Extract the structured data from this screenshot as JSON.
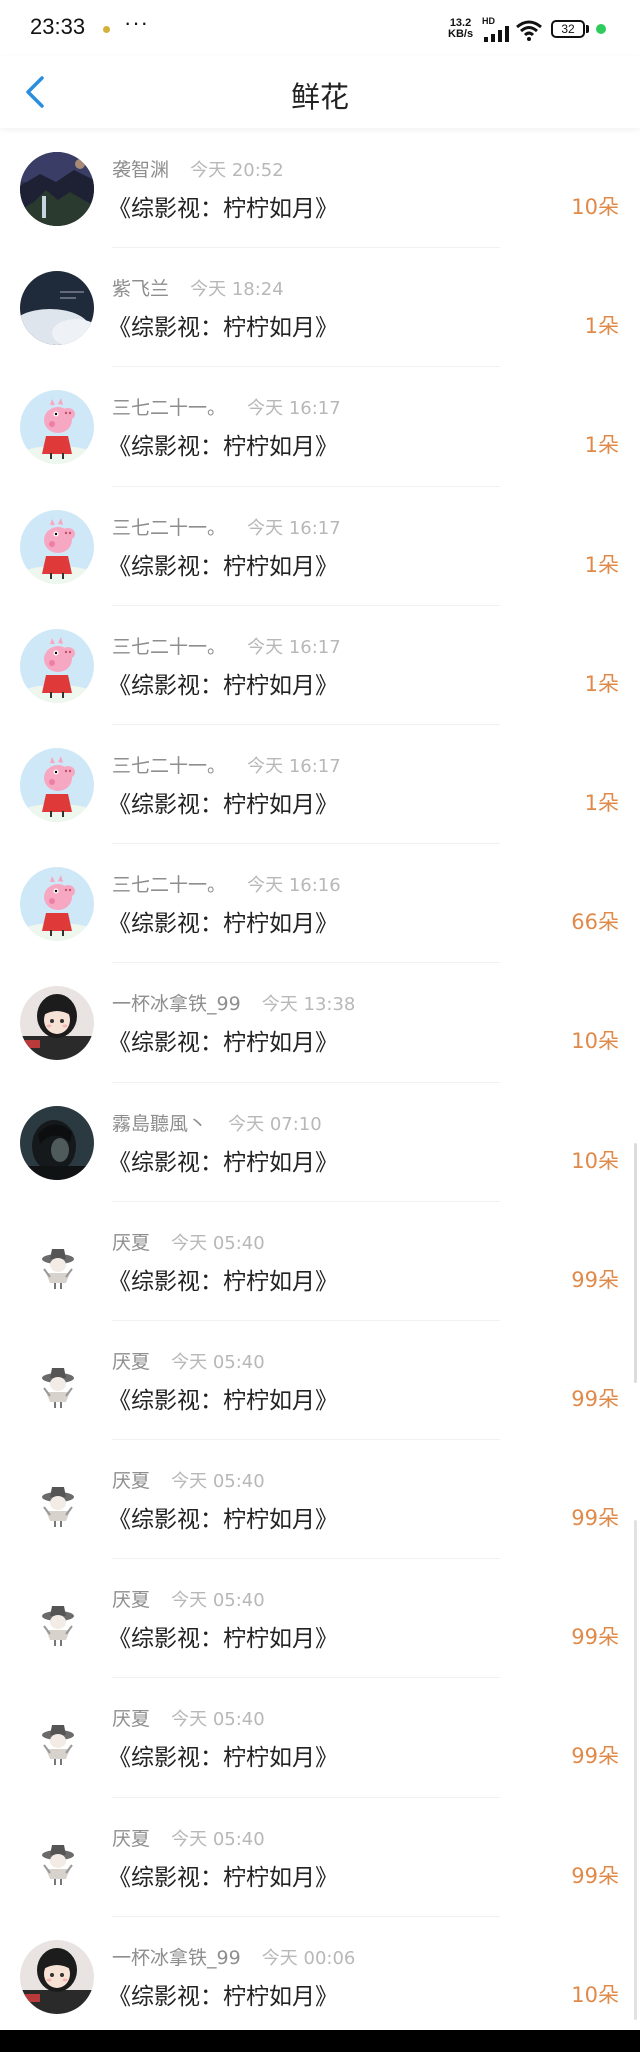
{
  "status": {
    "time": "23:33",
    "more": "···",
    "speed_top": "13.2",
    "speed_bottom": "KB/s",
    "hd": "HD",
    "battery": "32"
  },
  "nav": {
    "title": "鲜花"
  },
  "list": [
    {
      "user": "袭智渊",
      "time": "今天 20:52",
      "book": "《综影视：柠柠如月》",
      "count": "10朵",
      "avatar": "landscape"
    },
    {
      "user": "紫飞兰",
      "time": "今天 18:24",
      "book": "《综影视：柠柠如月》",
      "count": "1朵",
      "avatar": "sky"
    },
    {
      "user": "三七二十一。",
      "time": "今天 16:17",
      "book": "《综影视：柠柠如月》",
      "count": "1朵",
      "avatar": "peppa"
    },
    {
      "user": "三七二十一。",
      "time": "今天 16:17",
      "book": "《综影视：柠柠如月》",
      "count": "1朵",
      "avatar": "peppa"
    },
    {
      "user": "三七二十一。",
      "time": "今天 16:17",
      "book": "《综影视：柠柠如月》",
      "count": "1朵",
      "avatar": "peppa"
    },
    {
      "user": "三七二十一。",
      "time": "今天 16:17",
      "book": "《综影视：柠柠如月》",
      "count": "1朵",
      "avatar": "peppa"
    },
    {
      "user": "三七二十一。",
      "time": "今天 16:16",
      "book": "《综影视：柠柠如月》",
      "count": "66朵",
      "avatar": "peppa"
    },
    {
      "user": "一杯冰拿铁_99",
      "time": "今天 13:38",
      "book": "《综影视：柠柠如月》",
      "count": "10朵",
      "avatar": "girl"
    },
    {
      "user": "霧島聽風丶",
      "time": "今天 07:10",
      "book": "《综影视：柠柠如月》",
      "count": "10朵",
      "avatar": "dark"
    },
    {
      "user": "厌夏",
      "time": "今天 05:40",
      "book": "《综影视：柠柠如月》",
      "count": "99朵",
      "avatar": "sketch"
    },
    {
      "user": "厌夏",
      "time": "今天 05:40",
      "book": "《综影视：柠柠如月》",
      "count": "99朵",
      "avatar": "sketch"
    },
    {
      "user": "厌夏",
      "time": "今天 05:40",
      "book": "《综影视：柠柠如月》",
      "count": "99朵",
      "avatar": "sketch"
    },
    {
      "user": "厌夏",
      "time": "今天 05:40",
      "book": "《综影视：柠柠如月》",
      "count": "99朵",
      "avatar": "sketch"
    },
    {
      "user": "厌夏",
      "time": "今天 05:40",
      "book": "《综影视：柠柠如月》",
      "count": "99朵",
      "avatar": "sketch"
    },
    {
      "user": "厌夏",
      "time": "今天 05:40",
      "book": "《综影视：柠柠如月》",
      "count": "99朵",
      "avatar": "sketch"
    },
    {
      "user": "一杯冰拿铁_99",
      "time": "今天 00:06",
      "book": "《综影视：柠柠如月》",
      "count": "10朵",
      "avatar": "girl"
    }
  ],
  "colors": {
    "accent": "#e08a4a",
    "back": "#2a8ee0"
  }
}
